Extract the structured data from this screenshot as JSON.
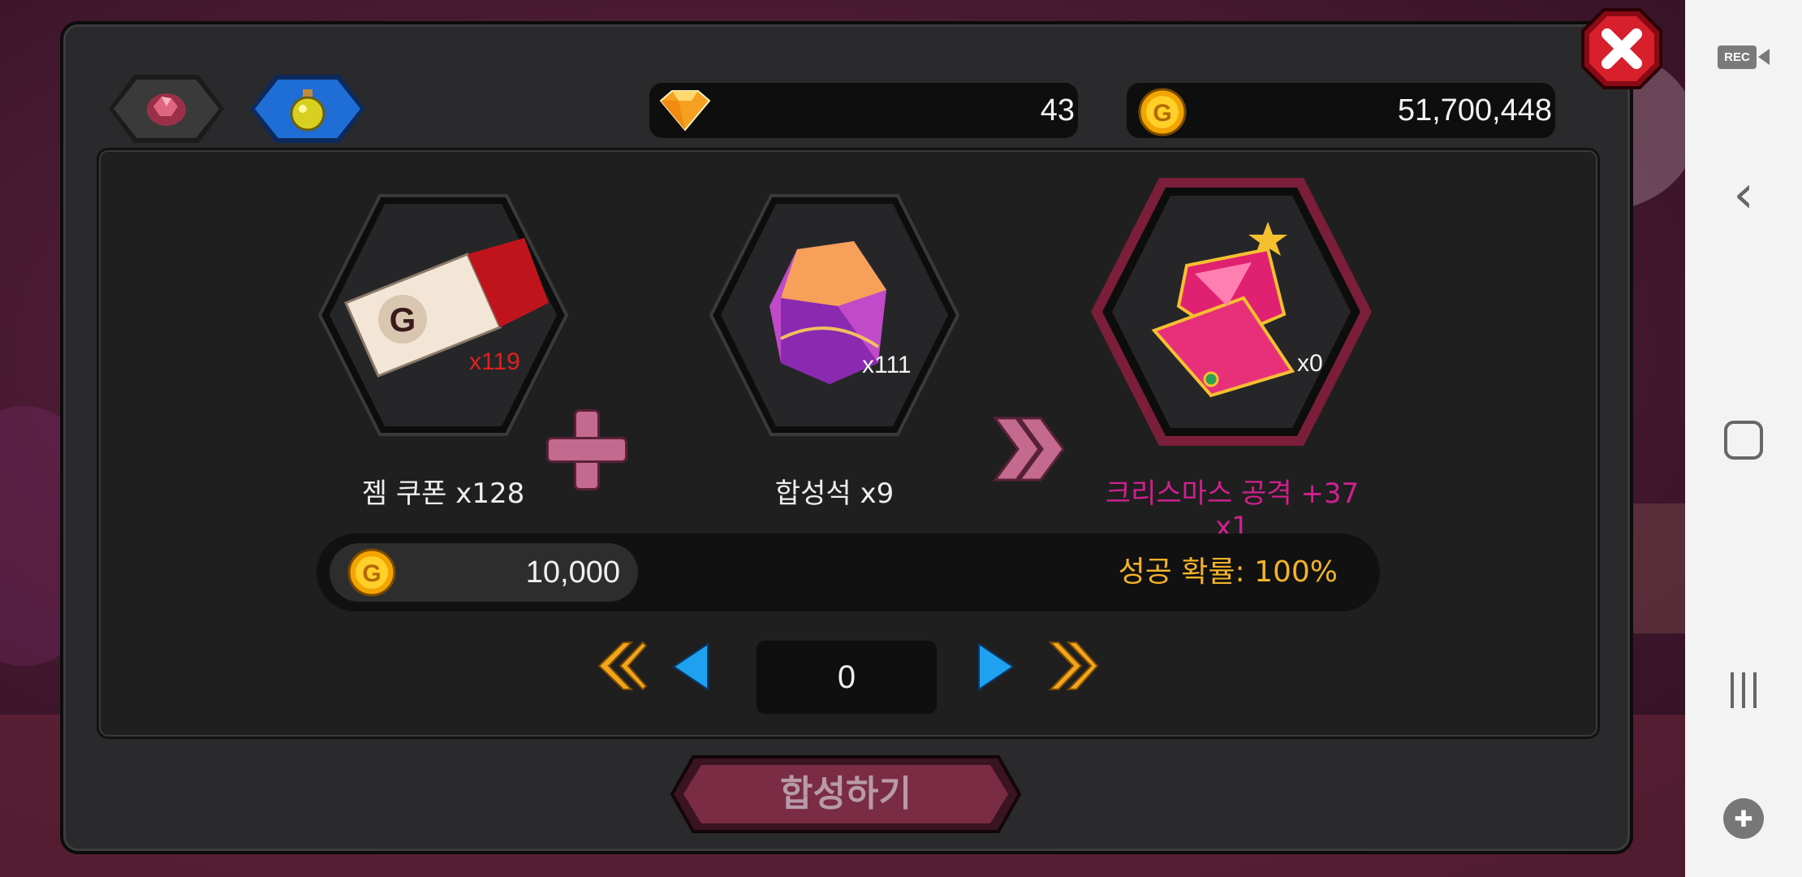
{
  "header": {
    "tabs": [
      {
        "icon": "gem-ore-icon",
        "active": false
      },
      {
        "icon": "potion-icon",
        "active": true
      }
    ],
    "gems": "43",
    "gold": "51,700,448",
    "close_icon": "close-icon"
  },
  "recipe": {
    "input1": {
      "label": "젬 쿠폰 x128",
      "owned": "x119",
      "icon": "gold-coupon-icon"
    },
    "input2": {
      "label": "합성석 x9",
      "owned": "x111",
      "icon": "synthesis-stone-icon"
    },
    "output": {
      "label": "크리스마스 공격 +37 x1",
      "owned": "x0",
      "icon": "christmas-tree-gem-icon"
    }
  },
  "cost": {
    "gold": "10,000",
    "success_rate": "성공 확률: 100%"
  },
  "quantity": "0",
  "synth_button": "합성하기",
  "colors": {
    "output_label": "#d0208e",
    "rate": "#f3b22a",
    "owned_red": "#e0201e"
  }
}
